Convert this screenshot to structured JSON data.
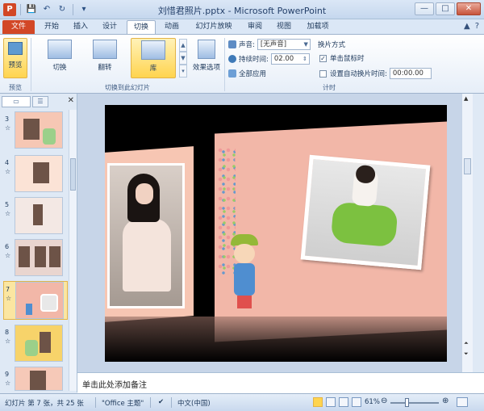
{
  "window": {
    "title": "刘惜君照片.pptx - Microsoft PowerPoint",
    "controls": {
      "minimize": "—",
      "maximize": "□",
      "close": "✕"
    }
  },
  "qat": {
    "save": "💾",
    "undo": "↶",
    "redo": "↻",
    "customize": "▾"
  },
  "tabs": [
    "文件",
    "开始",
    "插入",
    "设计",
    "切换",
    "动画",
    "幻灯片放映",
    "审阅",
    "视图",
    "加载项"
  ],
  "tabs_right": {
    "minimize_ribbon": "▲",
    "help": "?"
  },
  "ribbon": {
    "preview": {
      "label": "预览",
      "group": "预览"
    },
    "transitions": {
      "items": [
        "切换",
        "翻转",
        "库"
      ],
      "selected": "库",
      "effect_options": "效果选项",
      "group": "切换到此幻灯片"
    },
    "timing": {
      "sound_label": "声音:",
      "sound_value": "[无声音]",
      "duration_label": "持续时间:",
      "duration_value": "02.00",
      "apply_all": "全部应用",
      "advance_heading": "换片方式",
      "on_click_label": "单击鼠标时",
      "on_click_checked": true,
      "after_label": "设置自动换片时间:",
      "after_value": "00:00.00",
      "after_checked": false,
      "group": "计时"
    }
  },
  "slide_pane": {
    "tab_slides": "▭",
    "tab_outline": "☰",
    "close": "✕",
    "thumbnails": [
      {
        "num": "3",
        "star": "☆"
      },
      {
        "num": "4",
        "star": "☆"
      },
      {
        "num": "5",
        "star": "☆"
      },
      {
        "num": "6",
        "star": "☆"
      },
      {
        "num": "7",
        "star": "☆"
      },
      {
        "num": "8",
        "star": "☆"
      },
      {
        "num": "9",
        "star": "☆"
      }
    ],
    "active_num": "7"
  },
  "notes": {
    "placeholder": "单击此处添加备注"
  },
  "status": {
    "slide_info": "幻灯片 第 7 张，共 25 张",
    "theme": "\"Office 主题\"",
    "language": "中文(中国)",
    "zoom": "61%",
    "zoom_out": "⊖",
    "zoom_in": "⊕"
  }
}
